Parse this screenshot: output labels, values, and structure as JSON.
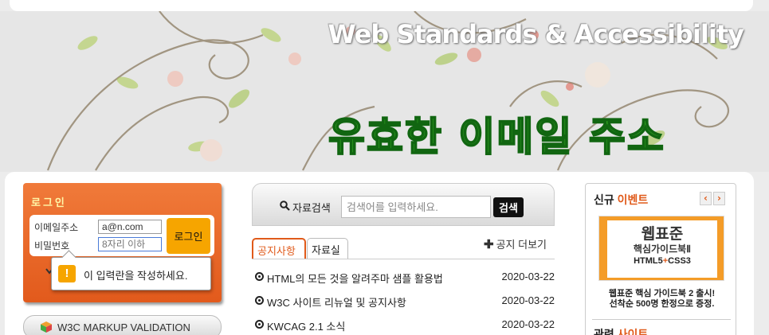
{
  "banner": {
    "tagline": "Web Standards & Accessibility",
    "title": "유효한 이메일 주소"
  },
  "login": {
    "title": "로그인",
    "email_label": "이메일주소",
    "email_value": "a@n.com",
    "password_label": "비밀번호",
    "password_placeholder": "8자리 이하",
    "submit_label": "로그인",
    "expand_icon": "chevron-down-icon"
  },
  "tooltip": {
    "icon": "!",
    "text": "이 입력란을 작성하세요."
  },
  "w3c": {
    "label": "W3C MARKUP VALIDATION",
    "icon": "cube-icon"
  },
  "search": {
    "label": "자료검색",
    "placeholder": "검색어를 입력하세요.",
    "button": "검색"
  },
  "tabs": [
    {
      "label": "공지사항",
      "active": true
    },
    {
      "label": "자료실",
      "active": false
    }
  ],
  "more_label": "공지 더보기",
  "notices": [
    {
      "title": "HTML의 모든 것을 알려주마 샘플 활용법",
      "date": "2020-03-22"
    },
    {
      "title": "W3C 사이트 리뉴얼 및 공지사항",
      "date": "2020-03-22"
    },
    {
      "title": "KWCAG 2.1 소식",
      "date": "2020-03-22"
    }
  ],
  "event": {
    "title_prefix": "신규",
    "title_accent": "이벤트",
    "prev": "‹",
    "next": "›",
    "book_title": "웹표준",
    "book_subtitle": "핵심가이드북Ⅱ",
    "book_html": "HTML5",
    "book_plus": "+",
    "book_css": "CSS3",
    "desc_line1": "웹표준 핵심 가이드북 2 출시!",
    "desc_line2": "선착순 500명 한정으로 증정.",
    "related_prefix": "관련",
    "related_accent": "사이트"
  },
  "colors": {
    "accent": "#e05a1a",
    "login_bg": "#ef6b2a",
    "banner_title": "#33aa22",
    "button_dark": "#111111"
  }
}
